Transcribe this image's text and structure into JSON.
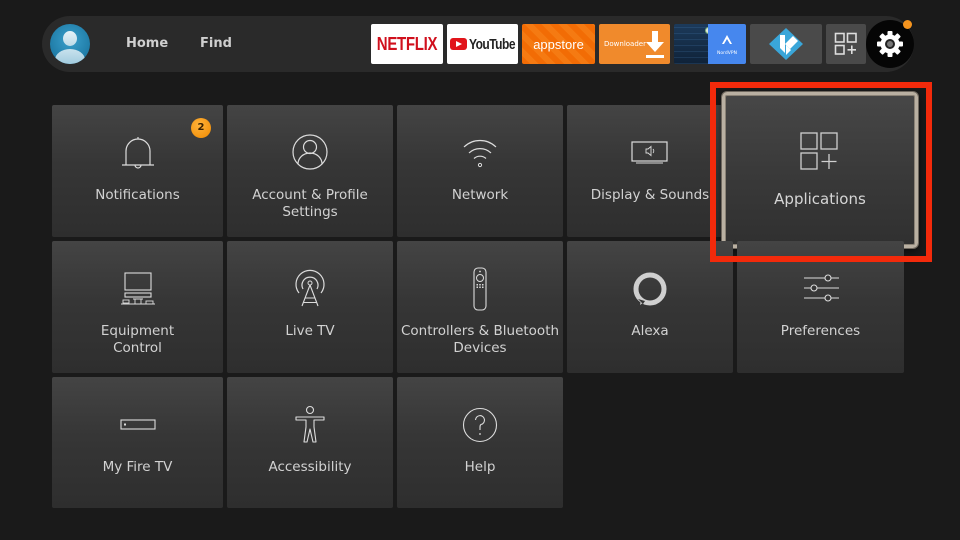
{
  "navbar": {
    "avatar_icon": "user-avatar-icon",
    "links": [
      {
        "label": "Home"
      },
      {
        "label": "Find"
      }
    ],
    "apps": [
      {
        "name": "Netflix",
        "label": "NETFLIX"
      },
      {
        "name": "YouTube",
        "label": "YouTube"
      },
      {
        "name": "Appstore",
        "label": "appstore"
      },
      {
        "name": "Downloader",
        "label": "Downloader"
      },
      {
        "name": "NordVPN",
        "label": "NordVPN"
      },
      {
        "name": "Kodi",
        "label": ""
      },
      {
        "name": "Apps & Channels",
        "label": ""
      }
    ],
    "settings_icon": "gear-icon",
    "settings_notification_color": "#f5941e"
  },
  "settings": {
    "tiles": [
      {
        "label": "Notifications",
        "icon": "bell-icon",
        "badge": "2"
      },
      {
        "label": "Account & Profile Settings",
        "label_line1": "Account & Profile",
        "label_line2": "Settings",
        "icon": "profile-icon"
      },
      {
        "label": "Network",
        "icon": "wifi-icon"
      },
      {
        "label": "Display & Sounds",
        "icon": "display-sound-icon"
      },
      {
        "label": "Applications",
        "icon": "applications-icon",
        "focused": true
      },
      {
        "label": "Equipment Control",
        "label_line1": "Equipment",
        "label_line2": "Control",
        "icon": "equipment-icon"
      },
      {
        "label": "Live TV",
        "icon": "antenna-icon"
      },
      {
        "label": "Controllers & Bluetooth Devices",
        "label_line1": "Controllers & Bluetooth",
        "label_line2": "Devices",
        "icon": "remote-icon"
      },
      {
        "label": "Alexa",
        "icon": "alexa-icon"
      },
      {
        "label": "Preferences",
        "icon": "sliders-icon"
      },
      {
        "label": "My Fire TV",
        "icon": "fire-tv-device-icon"
      },
      {
        "label": "Accessibility",
        "icon": "accessibility-icon"
      },
      {
        "label": "Help",
        "icon": "help-icon"
      }
    ]
  },
  "annotation": {
    "highlight_color": "#f32a0b",
    "highlight_target": "Applications"
  }
}
